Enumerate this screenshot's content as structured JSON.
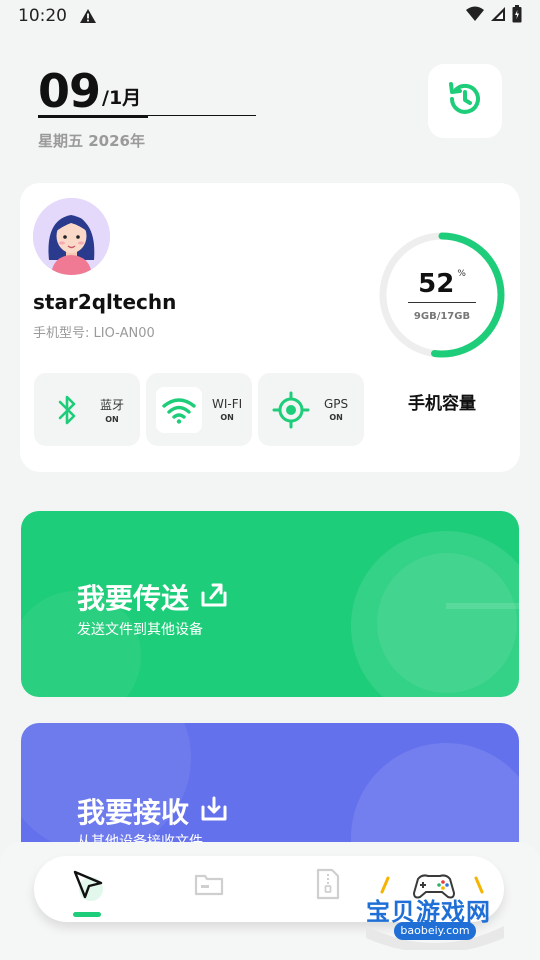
{
  "status_bar": {
    "time": "10:20"
  },
  "date": {
    "day": "09",
    "month": "/1月",
    "subtitle": "星期五  2026年"
  },
  "profile": {
    "username": "star2qltechn",
    "model": "手机型号: LIO-AN00"
  },
  "storage": {
    "percent": "52",
    "percent_sign": "%",
    "percent_value": 52,
    "usage": "9GB/17GB",
    "label": "手机容量"
  },
  "toggles": [
    {
      "name": "蓝牙",
      "state": "ON",
      "icon": "bluetooth-icon"
    },
    {
      "name": "WI-FI",
      "state": "ON",
      "icon": "wifi-icon"
    },
    {
      "name": "GPS",
      "state": "ON",
      "icon": "gps-icon"
    }
  ],
  "send": {
    "title": "我要传送",
    "subtitle": "发送文件到其他设备"
  },
  "receive": {
    "title": "我要接收",
    "subtitle": "从其他设备接收文件"
  },
  "nav": {
    "items": [
      "send-nav-icon",
      "folder-nav-icon",
      "archive-nav-icon",
      "game-nav-icon"
    ]
  },
  "watermark": {
    "text": "宝贝游戏网",
    "url": "baobeiy.com"
  },
  "colors": {
    "accent_green": "#1ecd79",
    "accent_blue": "#6471ec",
    "background": "#f3f5f4"
  }
}
